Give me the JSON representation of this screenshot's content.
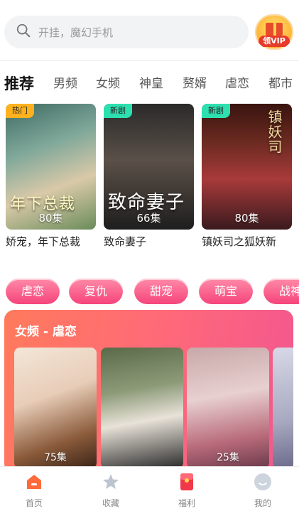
{
  "search": {
    "placeholder": "开挂，魔幻手机"
  },
  "vip": {
    "label": "领VIP"
  },
  "tabs": [
    "推荐",
    "男频",
    "女频",
    "神皇",
    "赘婿",
    "虐恋",
    "都市"
  ],
  "recommended": [
    {
      "title": "娇宠，年下总裁",
      "badge": "热门",
      "episodes": "80集",
      "poster_text": "年下总裁"
    },
    {
      "title": "致命妻子",
      "badge": "新剧",
      "episodes": "66集",
      "poster_text": "致命妻子"
    },
    {
      "title": "镇妖司之狐妖新",
      "badge": "新剧",
      "episodes": "80集",
      "poster_text": "镇妖司"
    }
  ],
  "chips": [
    "虐恋",
    "复仇",
    "甜宠",
    "萌宝",
    "战神"
  ],
  "section": {
    "title": "女频 - 虐恋",
    "items": [
      {
        "episodes": "75集"
      },
      {
        "episodes": ""
      },
      {
        "episodes": "25集"
      },
      {
        "episodes": ""
      }
    ]
  },
  "nav": [
    {
      "label": "首页",
      "icon": "home-icon",
      "active": true
    },
    {
      "label": "收藏",
      "icon": "star-icon",
      "active": false
    },
    {
      "label": "福利",
      "icon": "gift-envelope-icon",
      "active": false
    },
    {
      "label": "我的",
      "icon": "user-icon",
      "active": false
    }
  ],
  "colors": {
    "accent": "#f5447a",
    "brand_orange": "#ff6a3a",
    "badge_hot": "#ffb21e",
    "badge_new": "#2de0b0"
  }
}
